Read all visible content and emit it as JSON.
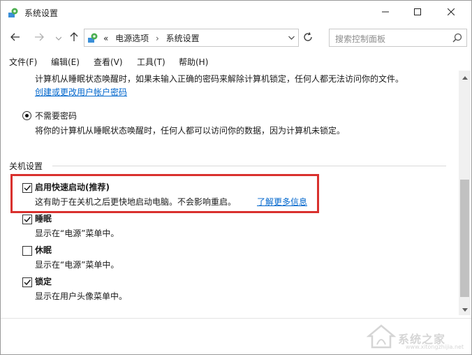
{
  "window": {
    "title": "系统设置",
    "icon": "control-panel-icon",
    "buttons": [
      "minimize-icon",
      "maximize-icon",
      "close-icon"
    ]
  },
  "address_bar": {
    "prefix": "«",
    "breadcrumbs": [
      "电源选项",
      "系统设置"
    ],
    "separator": "›"
  },
  "search": {
    "placeholder": "搜索控制面板"
  },
  "menu": {
    "items": [
      "文件(F)",
      "编辑(E)",
      "查看(V)",
      "工具(T)",
      "帮助(H)"
    ]
  },
  "password_section": {
    "top_desc": "计算机从睡眠状态唤醒时，如果未输入正确的密码来解除计算机锁定，任何人都无法访问你的文件。",
    "create_link": "创建或更改用户帐户密码",
    "no_password_label": "不需要密码",
    "no_password_selected": true,
    "no_password_desc": "将你的计算机从睡眠状态唤醒时，任何人都可以访问你的数据，因为计算机未锁定。"
  },
  "shutdown_settings": {
    "heading": "关机设置",
    "options": [
      {
        "label": "启用快速启动(推荐)",
        "checked": true,
        "desc": "这有助于在关机之后更快地启动电脑。不会影响重启。",
        "link": "了解更多信息",
        "highlighted": true
      },
      {
        "label": "睡眠",
        "checked": true,
        "desc": "显示在“电源”菜单中。"
      },
      {
        "label": "休眠",
        "checked": false,
        "desc": "显示在“电源”菜单中。"
      },
      {
        "label": "锁定",
        "checked": true,
        "desc": "显示在用户头像菜单中。"
      }
    ]
  },
  "highlight_color": "#d9312e",
  "watermark": {
    "text": "系统之家",
    "url": "www.xitongzhijia.net"
  }
}
